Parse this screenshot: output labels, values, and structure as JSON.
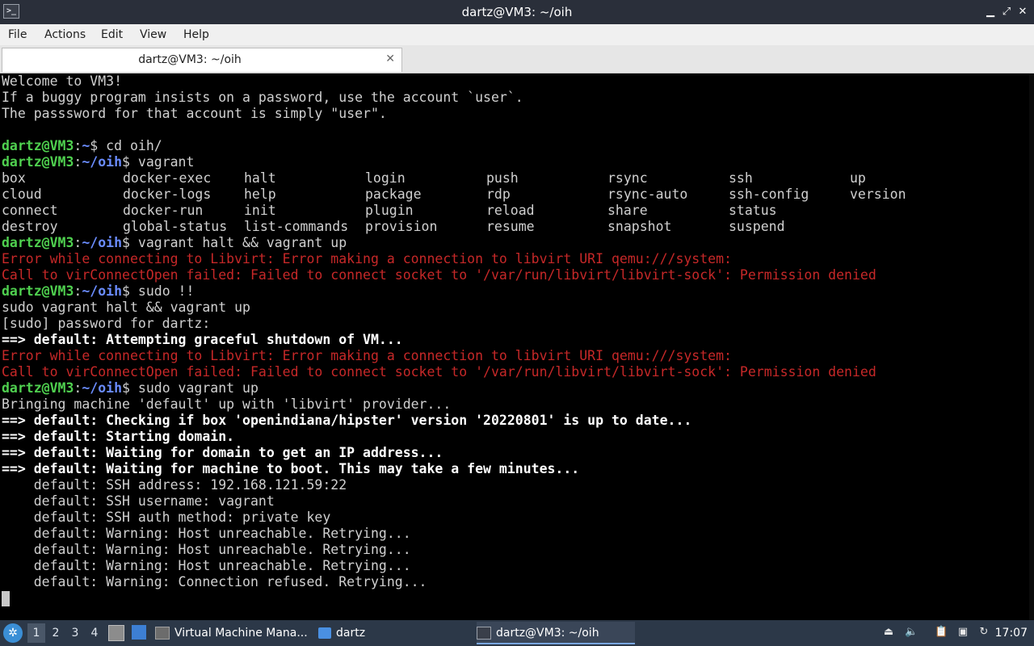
{
  "window": {
    "title": "dartz@VM3: ~/oih",
    "controls": [
      "minimize",
      "maximize",
      "close"
    ]
  },
  "menubar": {
    "items": [
      "File",
      "Actions",
      "Edit",
      "View",
      "Help"
    ]
  },
  "tabs": [
    {
      "label": "dartz@VM3: ~/oih",
      "close_icon": "✕"
    }
  ],
  "terminal": {
    "lines": [
      {
        "text": "Welcome to VM3!"
      },
      {
        "text": "If a buggy program insists on a password, use the account `user`."
      },
      {
        "text": "The passsword for that account is simply \"user\"."
      },
      {
        "text": ""
      },
      {
        "user": "dartz@VM3",
        "path": "~",
        "command": "cd oih/"
      },
      {
        "user": "dartz@VM3",
        "path": "~/oih",
        "command": "vagrant"
      },
      {
        "user": "dartz@VM3",
        "path": "~/oih",
        "command": "vagrant halt && vagrant up"
      },
      {
        "text": "Error while connecting to Libvirt: Error making a connection to libvirt URI qemu:///system:"
      },
      {
        "text": "Call to virConnectOpen failed: Failed to connect socket to '/var/run/libvirt/libvirt-sock': Permission denied"
      },
      {
        "user": "dartz@VM3",
        "path": "~/oih",
        "command": "sudo !!"
      },
      {
        "text": "sudo vagrant halt && vagrant up"
      },
      {
        "text": "[sudo] password for dartz:"
      },
      {
        "text": "==> default: Attempting graceful shutdown of VM..."
      },
      {
        "text": "Error while connecting to Libvirt: Error making a connection to libvirt URI qemu:///system:"
      },
      {
        "text": "Call to virConnectOpen failed: Failed to connect socket to '/var/run/libvirt/libvirt-sock': Permission denied"
      },
      {
        "user": "dartz@VM3",
        "path": "~/oih",
        "command": "sudo vagrant up"
      },
      {
        "text": "Bringing machine 'default' up with 'libvirt' provider..."
      },
      {
        "text": "==> default: Checking if box 'openindiana/hipster' version '20220801' is up to date..."
      },
      {
        "text": "==> default: Starting domain."
      },
      {
        "text": "==> default: Waiting for domain to get an IP address..."
      },
      {
        "text": "==> default: Waiting for machine to boot. This may take a few minutes..."
      },
      {
        "text": "    default: SSH address: 192.168.121.59:22"
      },
      {
        "text": "    default: SSH username: vagrant"
      },
      {
        "text": "    default: SSH auth method: private key"
      },
      {
        "text": "    default: Warning: Host unreachable. Retrying..."
      },
      {
        "text": "    default: Warning: Host unreachable. Retrying..."
      },
      {
        "text": "    default: Warning: Host unreachable. Retrying..."
      },
      {
        "text": "    default: Warning: Connection refused. Retrying..."
      }
    ],
    "vagrant_commands": [
      "box",
      "docker-exec",
      "halt",
      "login",
      "push",
      "rsync",
      "ssh",
      "up",
      "cloud",
      "docker-logs",
      "help",
      "package",
      "rdp",
      "rsync-auto",
      "ssh-config",
      "version",
      "connect",
      "docker-run",
      "init",
      "plugin",
      "reload",
      "share",
      "status",
      "destroy",
      "global-status",
      "list-commands",
      "provision",
      "resume",
      "snapshot",
      "suspend"
    ],
    "colors": {
      "prompt_user": "#4fd04f",
      "prompt_path": "#6a8cff",
      "error": "#c62828",
      "text": "#d0d0d0"
    }
  },
  "taskbar": {
    "workspaces": [
      "1",
      "2",
      "3",
      "4"
    ],
    "active_workspace": "1",
    "tasks": [
      {
        "label": "Virtual Machine Mana...",
        "icon": "virt-manager-icon"
      },
      {
        "label": "dartz",
        "icon": "folder-icon"
      },
      {
        "label": "dartz@VM3: ~/oih",
        "icon": "terminal-icon"
      }
    ],
    "clock": "17:07"
  }
}
